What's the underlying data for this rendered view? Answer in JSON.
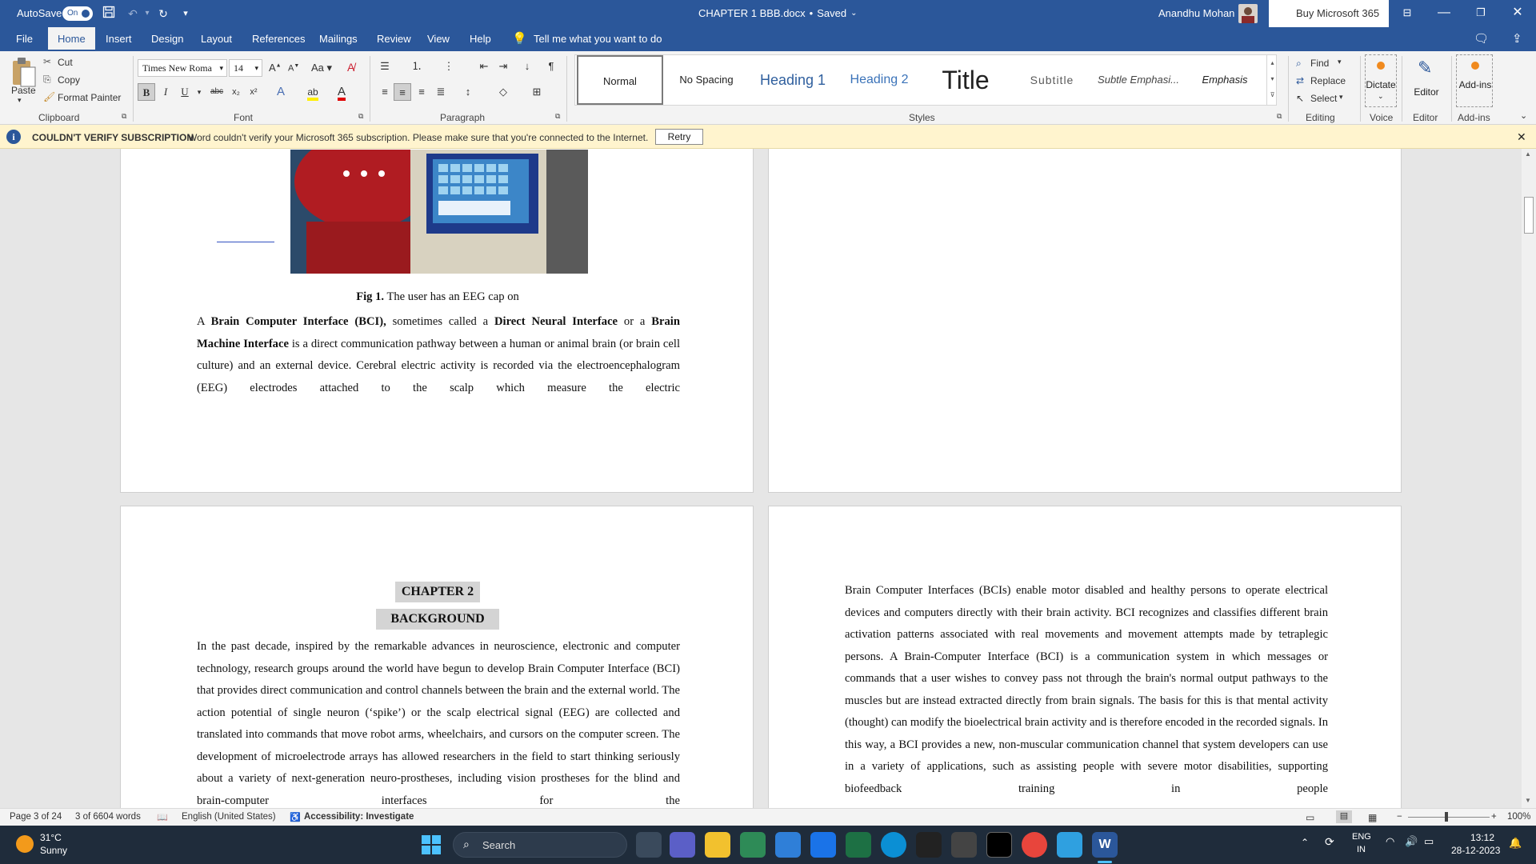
{
  "titlebar": {
    "autosave_label": "AutoSave",
    "autosave_state": "On",
    "doc_title": "CHAPTER 1 BBB.docx",
    "save_status": "Saved",
    "user_name": "Anandhu Mohan",
    "buy_label": "Buy Microsoft 365"
  },
  "tabs": [
    "File",
    "Home",
    "Insert",
    "Design",
    "Layout",
    "References",
    "Mailings",
    "Review",
    "View",
    "Help"
  ],
  "tell_me": "Tell me what you want to do",
  "clipboard": {
    "paste": "Paste",
    "cut": "Cut",
    "copy": "Copy",
    "format_painter": "Format Painter",
    "label": "Clipboard"
  },
  "font": {
    "name": "Times New Roma",
    "size": "14",
    "label": "Font"
  },
  "paragraph": {
    "label": "Paragraph"
  },
  "styles": {
    "items": [
      "Normal",
      "No Spacing",
      "Heading 1",
      "Heading 2",
      "Title",
      "Subtitle",
      "Subtle Emphasi...",
      "Emphasis"
    ],
    "label": "Styles"
  },
  "editing": {
    "find": "Find",
    "replace": "Replace",
    "select": "Select",
    "label": "Editing"
  },
  "voice": {
    "dictate": "Dictate",
    "label": "Voice"
  },
  "editor": {
    "btn": "Editor",
    "label": "Editor"
  },
  "addins": {
    "btn": "Add-ins",
    "label": "Add-ins"
  },
  "notification": {
    "title": "COULDN'T VERIFY SUBSCRIPTION",
    "message": "Word couldn't verify your Microsoft 365 subscription. Please make sure that you're connected to the Internet.",
    "retry": "Retry"
  },
  "document": {
    "fig_label": "Fig 1.",
    "fig_caption": " The user has an EEG cap on",
    "para1": {
      "a": "A ",
      "b1": "Brain Computer Interface (BCI),",
      "c": " sometimes called a ",
      "b2": "Direct Neural Interface",
      "d": " or a ",
      "b3": "Brain Machine Interface",
      "e": " is a direct communication pathway between a human or animal brain (or brain cell culture) and an external device. Cerebral electric activity is recorded via the electroencephalogram (EEG) electrodes attached to the scalp which measure the electric"
    },
    "chapter": "CHAPTER 2",
    "chapter_title": "BACKGROUND",
    "para2": "In the past decade, inspired by the remarkable advances in neuroscience, electronic and computer technology, research groups around the world have begun to develop Brain Computer Interface (BCI) that provides direct communication and control channels between the brain and the external world. The action potential of single neuron (‘spike’) or the scalp electrical signal (EEG) are collected and translated into commands that move robot arms, wheelchairs, and cursors on the computer screen. The development of microelectrode arrays has allowed researchers in the field to start thinking seriously about a variety of next-generation neuro-prostheses, including vision prostheses for the blind and brain-computer interfaces for the",
    "para3": "Brain Computer Interfaces (BCIs) enable motor disabled and healthy persons to operate electrical devices and computers directly with their brain activity. BCI recognizes and classifies different brain activation patterns associated with real movements and movement attempts made by tetraplegic persons. A Brain-Computer Interface (BCI) is a communication system in which messages or commands that a user wishes to convey pass not through the brain's normal output pathways to the muscles but are instead extracted directly from brain signals. The basis for this is that mental activity (thought) can modify the bioelectrical brain activity and is therefore encoded in the recorded signals. In this way, a BCI provides a new, non-muscular communication channel that system developers can use in a variety of applications, such as assisting people with severe motor disabilities, supporting biofeedback training in people"
  },
  "status": {
    "page": "Page 3 of 24",
    "words": "3 of 6604 words",
    "language": "English (United States)",
    "accessibility": "Accessibility: Investigate",
    "zoom": "100%"
  },
  "taskbar": {
    "temp": "31°C",
    "weather": "Sunny",
    "search": "Search",
    "lang1": "ENG",
    "lang2": "IN",
    "time": "13:12",
    "date": "28-12-2023"
  }
}
